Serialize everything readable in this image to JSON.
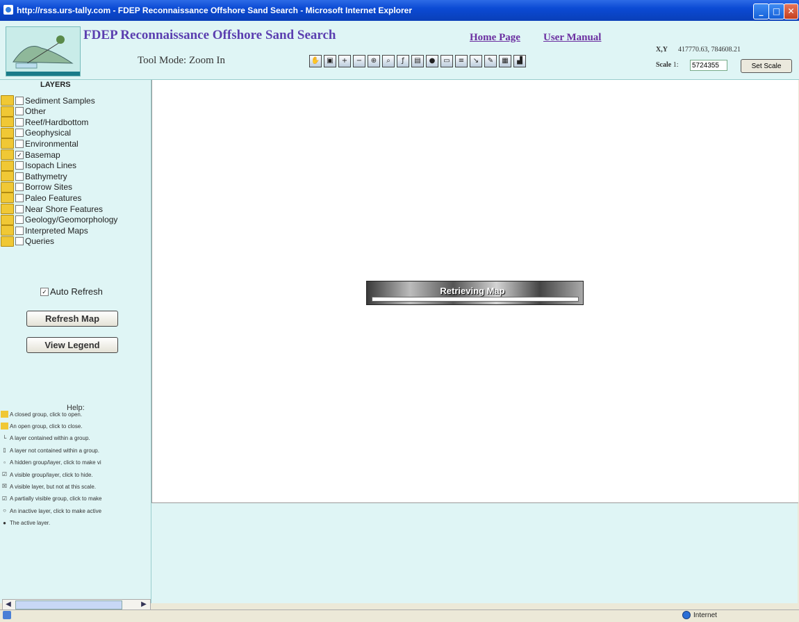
{
  "window": {
    "title": "http://rsss.urs-tally.com - FDEP Reconnaissance Offshore Sand Search - Microsoft Internet Explorer",
    "minimize": "_",
    "maximize": "□",
    "close": "✕"
  },
  "header": {
    "app_title": "FDEP Reconnaissance Offshore Sand Search",
    "tool_mode": "Tool Mode: Zoom In",
    "home_link": "Home Page",
    "manual_link": "User Manual",
    "xy_label": "X,Y",
    "xy_value": "417770.63, 784608.21",
    "scale_label": "Scale",
    "scale_prefix": "1:",
    "scale_value": "5724355",
    "set_scale": "Set Scale"
  },
  "toolbar": {
    "tools": [
      "pan-icon",
      "zoom-full-icon",
      "zoom-in-icon",
      "zoom-out-icon",
      "zoom-layer-icon",
      "zoom-active-icon",
      "identify-icon",
      "query-icon",
      "info-icon",
      "select-icon",
      "clear-icon",
      "measure-icon",
      "edit-icon",
      "print-icon",
      "buffer-icon"
    ]
  },
  "layers": {
    "heading": "LAYERS",
    "items": [
      {
        "label": "Sediment Samples",
        "checked": false
      },
      {
        "label": "Other",
        "checked": false
      },
      {
        "label": "Reef/Hardbottom",
        "checked": false
      },
      {
        "label": "Geophysical",
        "checked": false
      },
      {
        "label": "Environmental",
        "checked": false
      },
      {
        "label": "Basemap",
        "checked": true
      },
      {
        "label": "Isopach Lines",
        "checked": false
      },
      {
        "label": "Bathymetry",
        "checked": false
      },
      {
        "label": "Borrow Sites",
        "checked": false
      },
      {
        "label": "Paleo Features",
        "checked": false
      },
      {
        "label": "Near Shore Features",
        "checked": false
      },
      {
        "label": "Geology/Geomorphology",
        "checked": false
      },
      {
        "label": "Interpreted Maps",
        "checked": false
      },
      {
        "label": "Queries",
        "checked": false
      }
    ]
  },
  "controls": {
    "auto_refresh": "Auto Refresh",
    "refresh_map": "Refresh Map",
    "view_legend": "View Legend"
  },
  "help": {
    "heading": "Help:",
    "items": [
      "A closed group, click to open.",
      "An open group, click to close.",
      "A layer contained within a group.",
      "A layer not contained within a group.",
      "A hidden group/layer, click to make vi",
      "A visible group/layer, click to hide.",
      "A visible layer, but not at this scale.",
      "A partially visible group, click to make",
      "An inactive layer, click to make active",
      "The active layer."
    ]
  },
  "map": {
    "loading_text": "Retrieving Map"
  },
  "status": {
    "zone": "Internet"
  }
}
